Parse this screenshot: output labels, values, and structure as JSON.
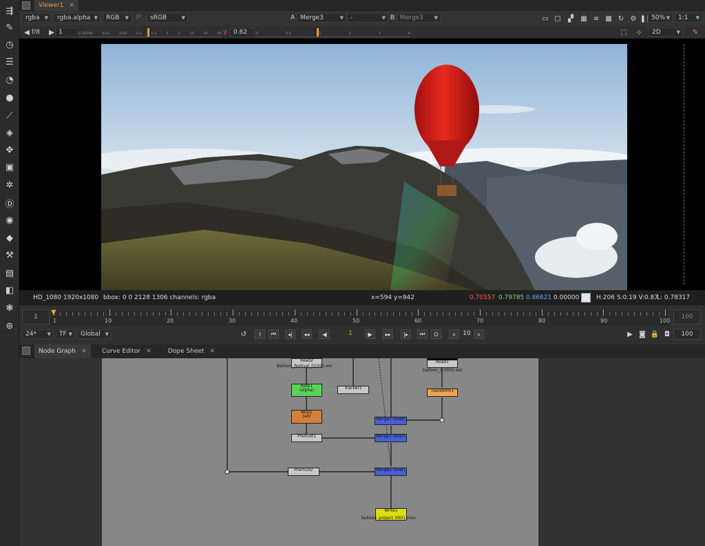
{
  "tabs": {
    "viewer": "Viewer1",
    "node_graph": "Node Graph",
    "curve_editor": "Curve Editor",
    "dope_sheet": "Dope Sheet"
  },
  "toolbar1": {
    "channels": "rgba",
    "alpha": "rgba.alpha",
    "display": "RGB",
    "ip": "IP",
    "lut": "sRGB",
    "a_label": "A",
    "a_input": "Merge3",
    "op": "-",
    "b_label": "B",
    "b_input": "Merge3",
    "zoom": "50%",
    "ratio": "1:1"
  },
  "toolbar2": {
    "fstop": "f/8",
    "frame": "1",
    "gamma_label": "y",
    "gamma": "0.62",
    "view_mode": "2D",
    "gain_ticks": [
      "0.00390",
      "0.01",
      "0.03",
      "0.1",
      "0.2",
      "1",
      "2",
      "10",
      "20",
      "64"
    ],
    "gamma_ticks": [
      "0",
      "0.5",
      "1",
      "2",
      "3",
      "4"
    ]
  },
  "info": {
    "format": "HD_1080 1920x1080",
    "bbox": "bbox: 0 0 2128 1306 channels: rgba",
    "coords": "x=594 y=942",
    "r": "0.70557",
    "g": "0.79785",
    "b": "0.86621",
    "a": "0.00000",
    "hsv": "H:206 S:0.19 V:0.87",
    "lum": "L: 0.78317",
    "colors": {
      "r": "#ff5a5a",
      "g": "#7ddc7d",
      "b": "#6ca8ff"
    }
  },
  "timeline": {
    "start": "1",
    "end": "100",
    "ticks": [
      "1",
      "10",
      "20",
      "30",
      "40",
      "50",
      "60",
      "70",
      "80",
      "90",
      "100"
    ],
    "fps": "24*",
    "tf": "TF",
    "scope": "Global",
    "current": "1",
    "step": "10",
    "end_frame": "100",
    "playhead_frame": 1
  },
  "nodes": {
    "read2": {
      "name": "Read2",
      "file": "Balloon_festival_01001.exr"
    },
    "read1": {
      "name": "Read1",
      "file": "balloon_1.0001.exr"
    },
    "roto1": {
      "name": "Roto1",
      "sub": "(alpha)"
    },
    "tracker1": {
      "name": "Tracker1"
    },
    "transform1": {
      "name": "Transform1"
    },
    "blur1": {
      "name": "Blur1",
      "sub": "(all)"
    },
    "merge2": {
      "name": "Merge2 (over)"
    },
    "premult1": {
      "name": "Premult1"
    },
    "merge1": {
      "name": "Merge1 (over)"
    },
    "premult2": {
      "name": "Premult2"
    },
    "merge3": {
      "name": "Merge3 (over)"
    },
    "write1": {
      "name": "Write1",
      "file": "balloon_project_0001.mov"
    }
  }
}
